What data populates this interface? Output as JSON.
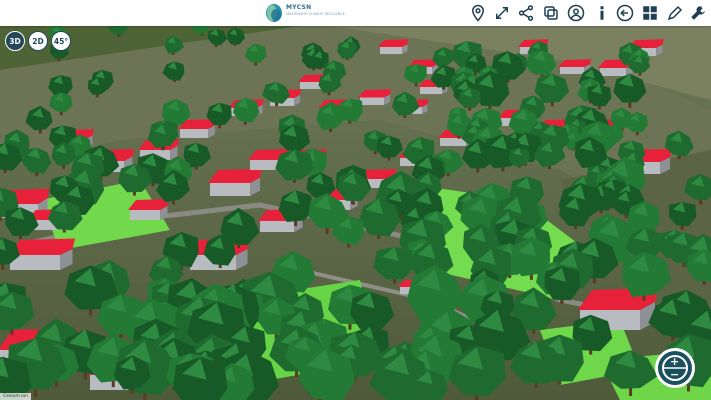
{
  "app": {
    "logo_title": "MYCSN",
    "logo_subtitle": "MAXIMISING CLIMATE RESILIENCE"
  },
  "toolbar": {
    "items": [
      {
        "name": "location-pin-icon"
      },
      {
        "name": "expand-arrows-icon"
      },
      {
        "name": "share-icon"
      },
      {
        "name": "layers-icon"
      },
      {
        "name": "user-icon"
      },
      {
        "name": "info-icon"
      },
      {
        "name": "back-arrow-icon"
      },
      {
        "name": "grid-icon"
      },
      {
        "name": "pencil-icon"
      },
      {
        "name": "wrench-icon"
      }
    ]
  },
  "view_controls": {
    "mode_3d": "3D",
    "mode_2d": "2D",
    "angle": "45°",
    "active": "3D"
  },
  "zoom": {
    "plus": "+",
    "minus": "−"
  },
  "attribution": {
    "text": "Cesium ion"
  },
  "colors": {
    "roof": "#e8213a",
    "tree": "#1f6b2f",
    "grass": "#6fd84a",
    "terrain": "#5a6a3c",
    "brand": "#2f6f93",
    "control": "#1a4f5d"
  }
}
